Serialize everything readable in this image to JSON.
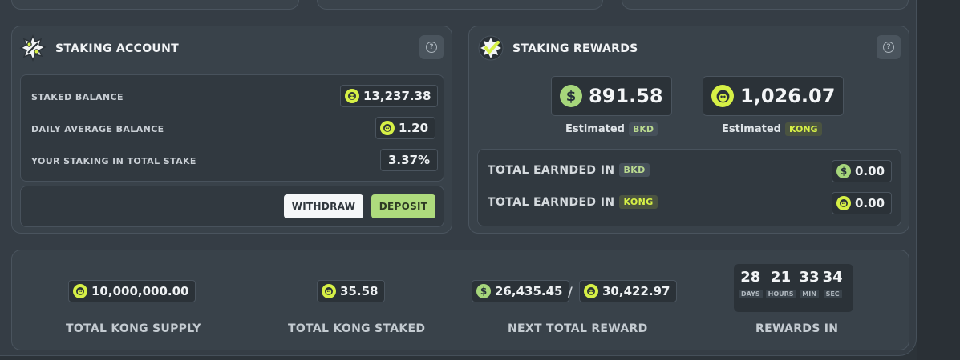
{
  "colors": {
    "accent_green": "#aedb7d",
    "kong_yellow": "#d6f046",
    "panel": "#39424a",
    "background": "#2c3339"
  },
  "staking_account": {
    "title": "STAKING ACCOUNT",
    "icon": "percent-badge-icon",
    "help_icon": "question-icon",
    "rows": [
      {
        "label": "STAKED BALANCE",
        "value": "13,237.38",
        "coin": "kong"
      },
      {
        "label": "DAILY AVERAGE BALANCE",
        "value": "1.20",
        "coin": "kong"
      },
      {
        "label": "YOUR STAKING IN TOTAL STAKE",
        "value": "3.37%",
        "coin": "none"
      }
    ],
    "withdraw_label": "WITHDRAW",
    "deposit_label": "DEPOSIT"
  },
  "staking_rewards": {
    "title": "STAKING REWARDS",
    "icon": "checkmark-badge-icon",
    "help_icon": "question-icon",
    "estimated_bkd": {
      "value": "891.58",
      "label": "Estimated",
      "tag": "BKD"
    },
    "estimated_kong": {
      "value": "1,026.07",
      "label": "Estimated",
      "tag": "KONG"
    },
    "earned": [
      {
        "label": "TOTAL EARNDED IN",
        "tag": "BKD",
        "value": "0.00"
      },
      {
        "label": "TOTAL EARNDED IN",
        "tag": "KONG",
        "value": "0.00"
      }
    ]
  },
  "stats": {
    "total_supply": {
      "value": "10,000,000.00",
      "label": "TOTAL KONG SUPPLY"
    },
    "total_staked": {
      "value": "35.58",
      "label": "TOTAL KONG STAKED"
    },
    "next_reward": {
      "bkd_value": "26,435.45",
      "separator": "/",
      "kong_value": "30,422.97",
      "label": "NEXT TOTAL REWARD"
    },
    "rewards_in": {
      "label": "REWARDS IN",
      "days": "28",
      "days_unit": "DAYS",
      "hours": "21",
      "hours_unit": "HOURS",
      "min": "33",
      "min_unit": "MIN",
      "sec": "34",
      "sec_unit": "SEC"
    }
  }
}
